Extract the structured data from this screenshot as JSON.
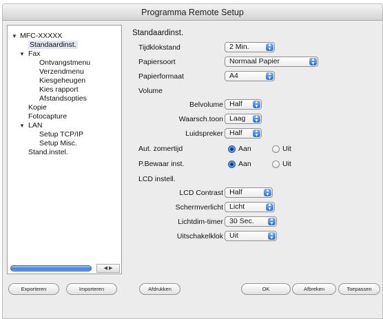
{
  "window": {
    "title": "Programma Remote Setup"
  },
  "tree": {
    "items": [
      {
        "label": "MFC-XXXXX",
        "expanded": true
      },
      {
        "label": "Standaardinst.",
        "selected": true
      },
      {
        "label": "Fax",
        "expanded": true
      },
      {
        "label": "Ontvangstmenu"
      },
      {
        "label": "Verzendmenu"
      },
      {
        "label": "Kiesgeheugen"
      },
      {
        "label": "Kies rapport"
      },
      {
        "label": "Afstandsopties"
      },
      {
        "label": "Kopie"
      },
      {
        "label": "Fotocapture"
      },
      {
        "label": "LAN",
        "expanded": true
      },
      {
        "label": "Setup TCP/IP"
      },
      {
        "label": "Setup Misc."
      },
      {
        "label": "Stand.instel."
      }
    ]
  },
  "main": {
    "title": "Standaardinst.",
    "tijdklokstand": {
      "label": "Tijdklokstand",
      "value": "2 Min."
    },
    "papiersoort": {
      "label": "Papiersoort",
      "value": "Normaal Papier"
    },
    "papierformaat": {
      "label": "Papierformaat",
      "value": "A4"
    },
    "volume": {
      "label": "Volume",
      "belvolume": {
        "label": "Belvolume",
        "value": "Half"
      },
      "waarsch": {
        "label": "Waarsch.toon",
        "value": "Laag"
      },
      "luidspreker": {
        "label": "Luidspreker",
        "value": "Half"
      }
    },
    "zomertijd": {
      "label": "Aut. zomertijd",
      "options": [
        "Aan",
        "Uit"
      ],
      "selected": "Aan"
    },
    "pbewaar": {
      "label": "P.Bewaar inst.",
      "options": [
        "Aan",
        "Uit"
      ],
      "selected": "Aan"
    },
    "lcd": {
      "label": "LCD instell.",
      "contrast": {
        "label": "LCD Contrast",
        "value": "Half"
      },
      "schermverlicht": {
        "label": "Schermverlicht",
        "value": "Licht"
      },
      "lichtdim": {
        "label": "Lichtdim-timer",
        "value": "30 Sec."
      },
      "uitschakelklok": {
        "label": "Uitschakelklok",
        "value": "Uit"
      }
    }
  },
  "buttons": {
    "exporteren": "Exporteren",
    "importeren": "Importeren",
    "afdrukken": "Afdrukken",
    "ok": "OK",
    "afbreken": "Afbreken",
    "toepassen": "Toepassen"
  },
  "icons": {
    "expand": "disclosure-triangle-icon",
    "popup": "popup-arrows-icon",
    "scroll_left": "scroll-left-icon",
    "scroll_right": "scroll-right-icon"
  },
  "colors": {
    "accent": "#2f72d6",
    "selection": "#dfe6ef"
  }
}
